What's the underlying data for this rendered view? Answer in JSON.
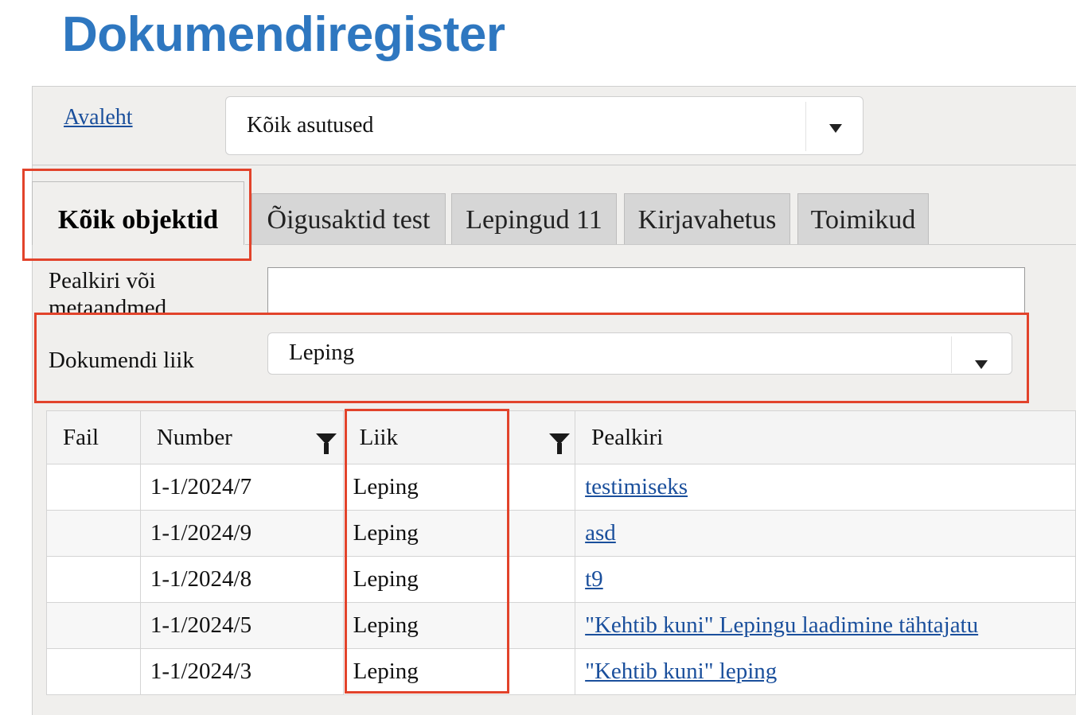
{
  "app": {
    "title": "Dokumendiregister"
  },
  "topbar": {
    "home_link": "Avaleht",
    "org_select": {
      "value": "Kõik asutused"
    }
  },
  "tabs": [
    {
      "label": "Kõik objektid",
      "active": true
    },
    {
      "label": "Õigusaktid test",
      "active": false
    },
    {
      "label": "Lepingud 11",
      "active": false
    },
    {
      "label": "Kirjavahetus",
      "active": false
    },
    {
      "label": "Toimikud",
      "active": false
    }
  ],
  "filters": {
    "title_label": "Pealkiri või metaandmed",
    "title_value": "",
    "doc_type_label": "Dokumendi liik",
    "doc_type_value": "Leping"
  },
  "table": {
    "columns": [
      "Fail",
      "Number",
      "Liik",
      "Pealkiri"
    ],
    "rows": [
      {
        "fail": "",
        "number": "1-1/2024/7",
        "liik": "Leping",
        "pealkiri": "testimiseks"
      },
      {
        "fail": "",
        "number": "1-1/2024/9",
        "liik": "Leping",
        "pealkiri": "asd"
      },
      {
        "fail": "",
        "number": "1-1/2024/8",
        "liik": "Leping",
        "pealkiri": "t9"
      },
      {
        "fail": "",
        "number": "1-1/2024/5",
        "liik": "Leping",
        "pealkiri": "\"Kehtib kuni\" Lepingu laadimine tähtajatu"
      },
      {
        "fail": "",
        "number": "1-1/2024/3",
        "liik": "Leping",
        "pealkiri": "\"Kehtib kuni\" leping"
      }
    ]
  },
  "colors": {
    "brand": "#2e77c0",
    "highlight": "#e2432b",
    "link": "#1a4f9c"
  },
  "icons": {
    "dropdown": "chevron-down-icon",
    "filter": "filter-icon"
  }
}
